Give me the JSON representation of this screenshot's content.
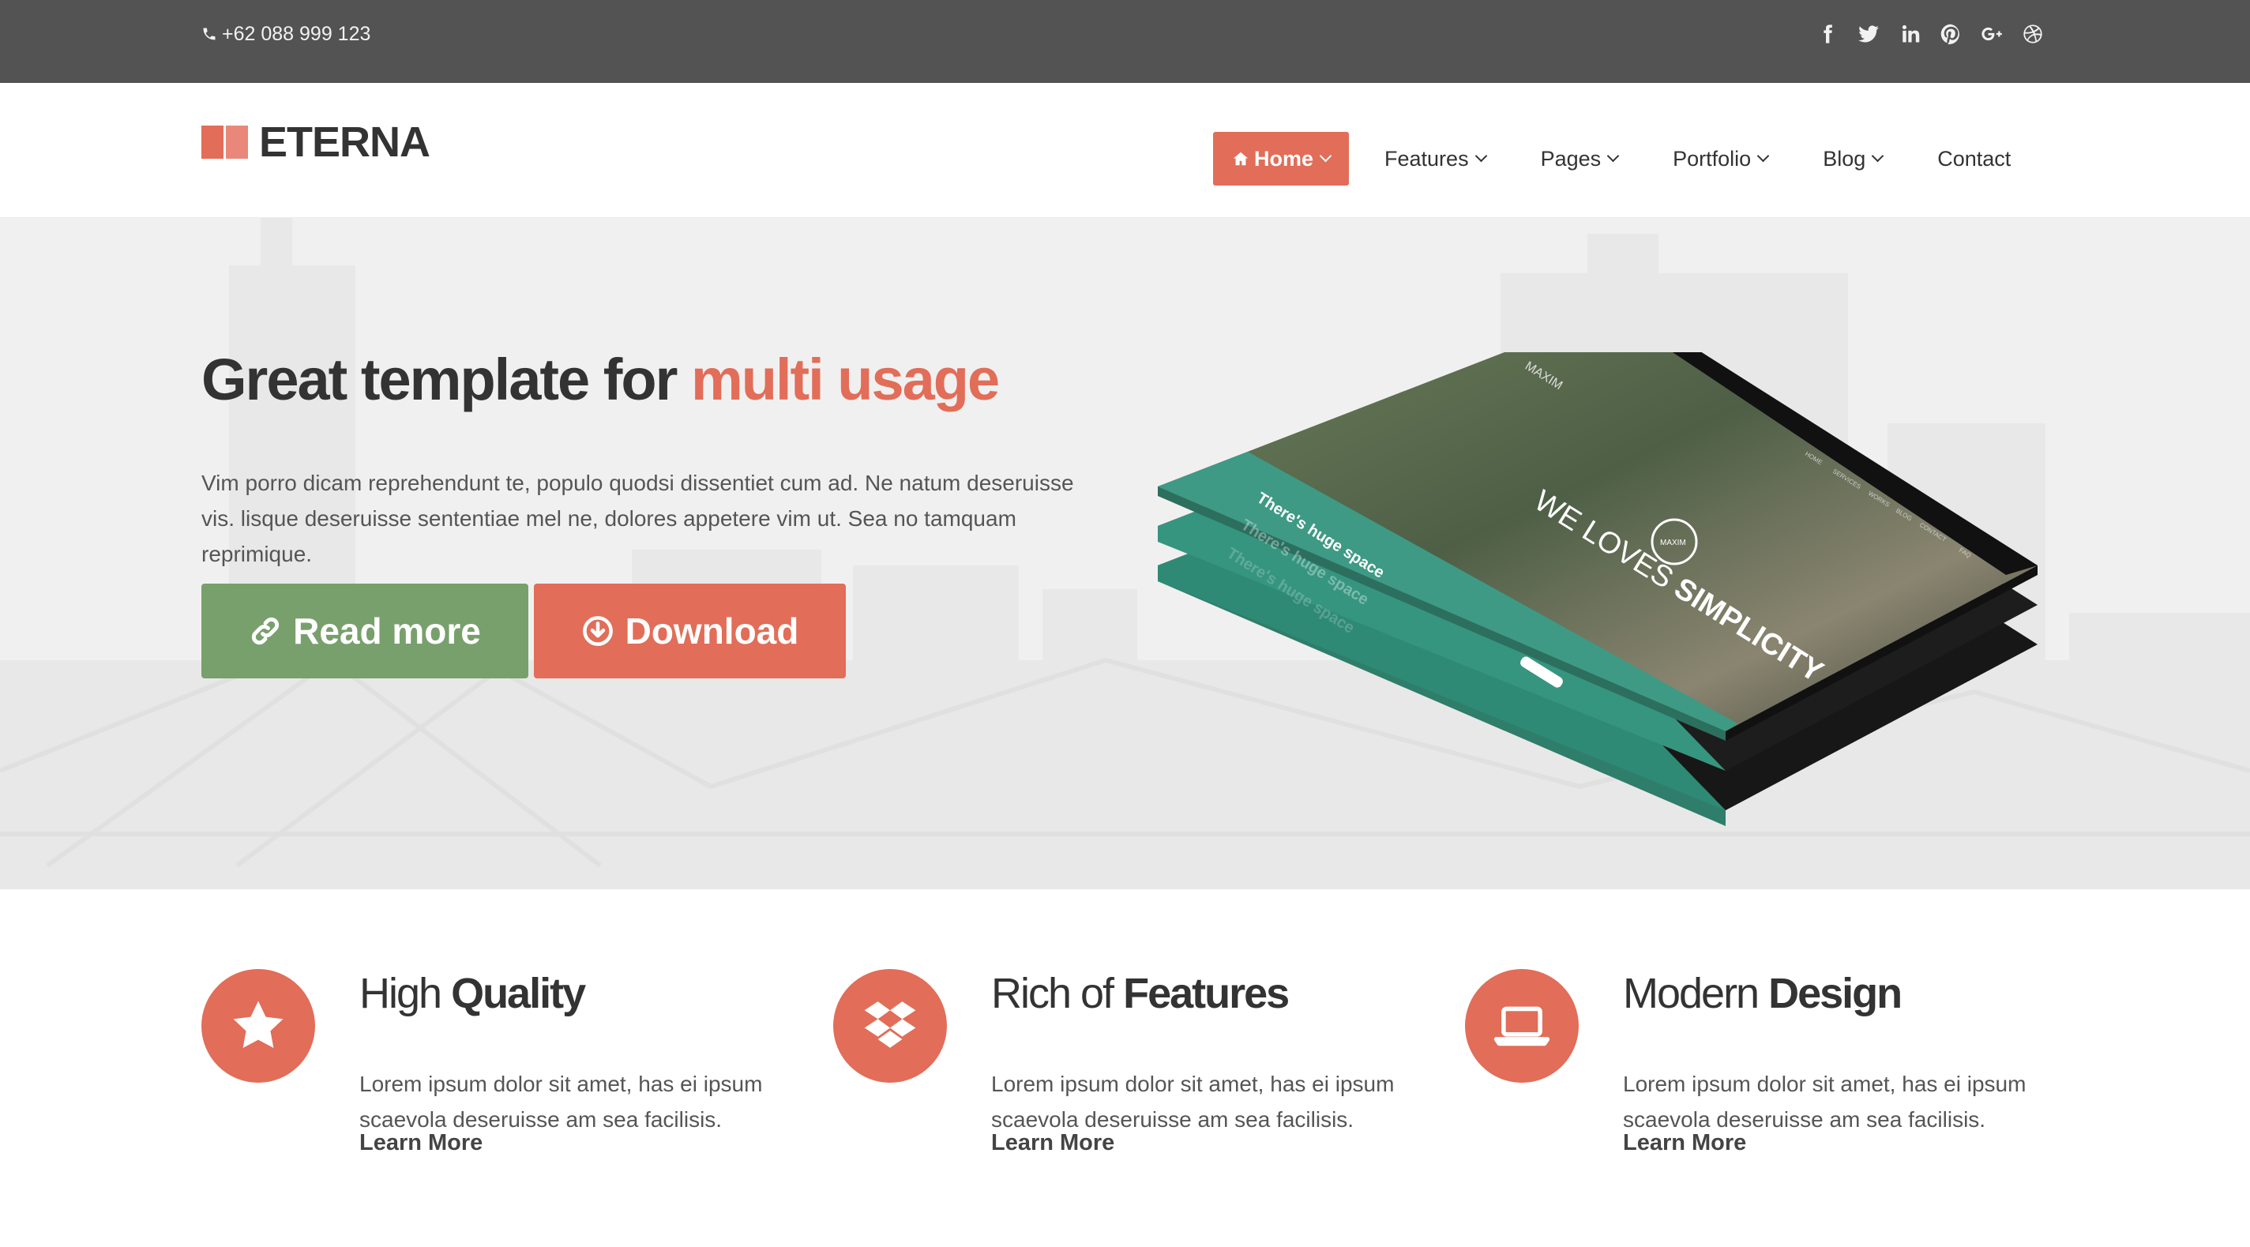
{
  "topbar": {
    "phone": "+62 088 999 123",
    "phone_icon": "phone-icon",
    "socials": [
      "facebook-icon",
      "twitter-icon",
      "linkedin-icon",
      "pinterest-icon",
      "google-plus-icon",
      "dribbble-icon"
    ]
  },
  "header": {
    "logo_text": "ETERNA",
    "nav": {
      "home": "Home",
      "features": "Features",
      "pages": "Pages",
      "portfolio": "Portfolio",
      "blog": "Blog",
      "contact": "Contact"
    }
  },
  "hero": {
    "title_main": "Great template for ",
    "title_accent": "multi usage",
    "text": "Vim porro dicam reprehendunt te, populo quodsi dissentiet cum ad. Ne natum deseruisse vis. lisque deseruisse sententiae mel ne, dolores appetere vim ut. Sea no tamquam reprimique.",
    "read_more": "Read more",
    "download": "Download",
    "mockup": {
      "brand": "MAXIM",
      "headline": "WE LOVES",
      "headline_bold": "SIMPLICITY",
      "badge": "MAXIM",
      "tagline": "There's huge space",
      "menu": [
        "HOME",
        "SERVICES",
        "WORKS",
        "BLOG",
        "CONTACT",
        "FAQ"
      ]
    }
  },
  "features": [
    {
      "title_light": "High ",
      "title_bold": "Quality",
      "text": "Lorem ipsum dolor sit amet, has ei ipsum scaevola deseruisse am sea facilisis.",
      "link": "Learn More",
      "icon": "star-icon"
    },
    {
      "title_light": "Rich of ",
      "title_bold": "Features",
      "text": "Lorem ipsum dolor sit amet, has ei ipsum scaevola deseruisse am sea facilisis.",
      "link": "Learn More",
      "icon": "dropbox-icon"
    },
    {
      "title_light": "Modern ",
      "title_bold": "Design",
      "text": "Lorem ipsum dolor sit amet, has ei ipsum scaevola deseruisse am sea facilisis.",
      "link": "Learn More",
      "icon": "laptop-icon"
    }
  ],
  "colors": {
    "accent": "#e26d58",
    "green": "#78a06c",
    "topbar": "#535353",
    "mockup_teal": "#3e9a84"
  }
}
